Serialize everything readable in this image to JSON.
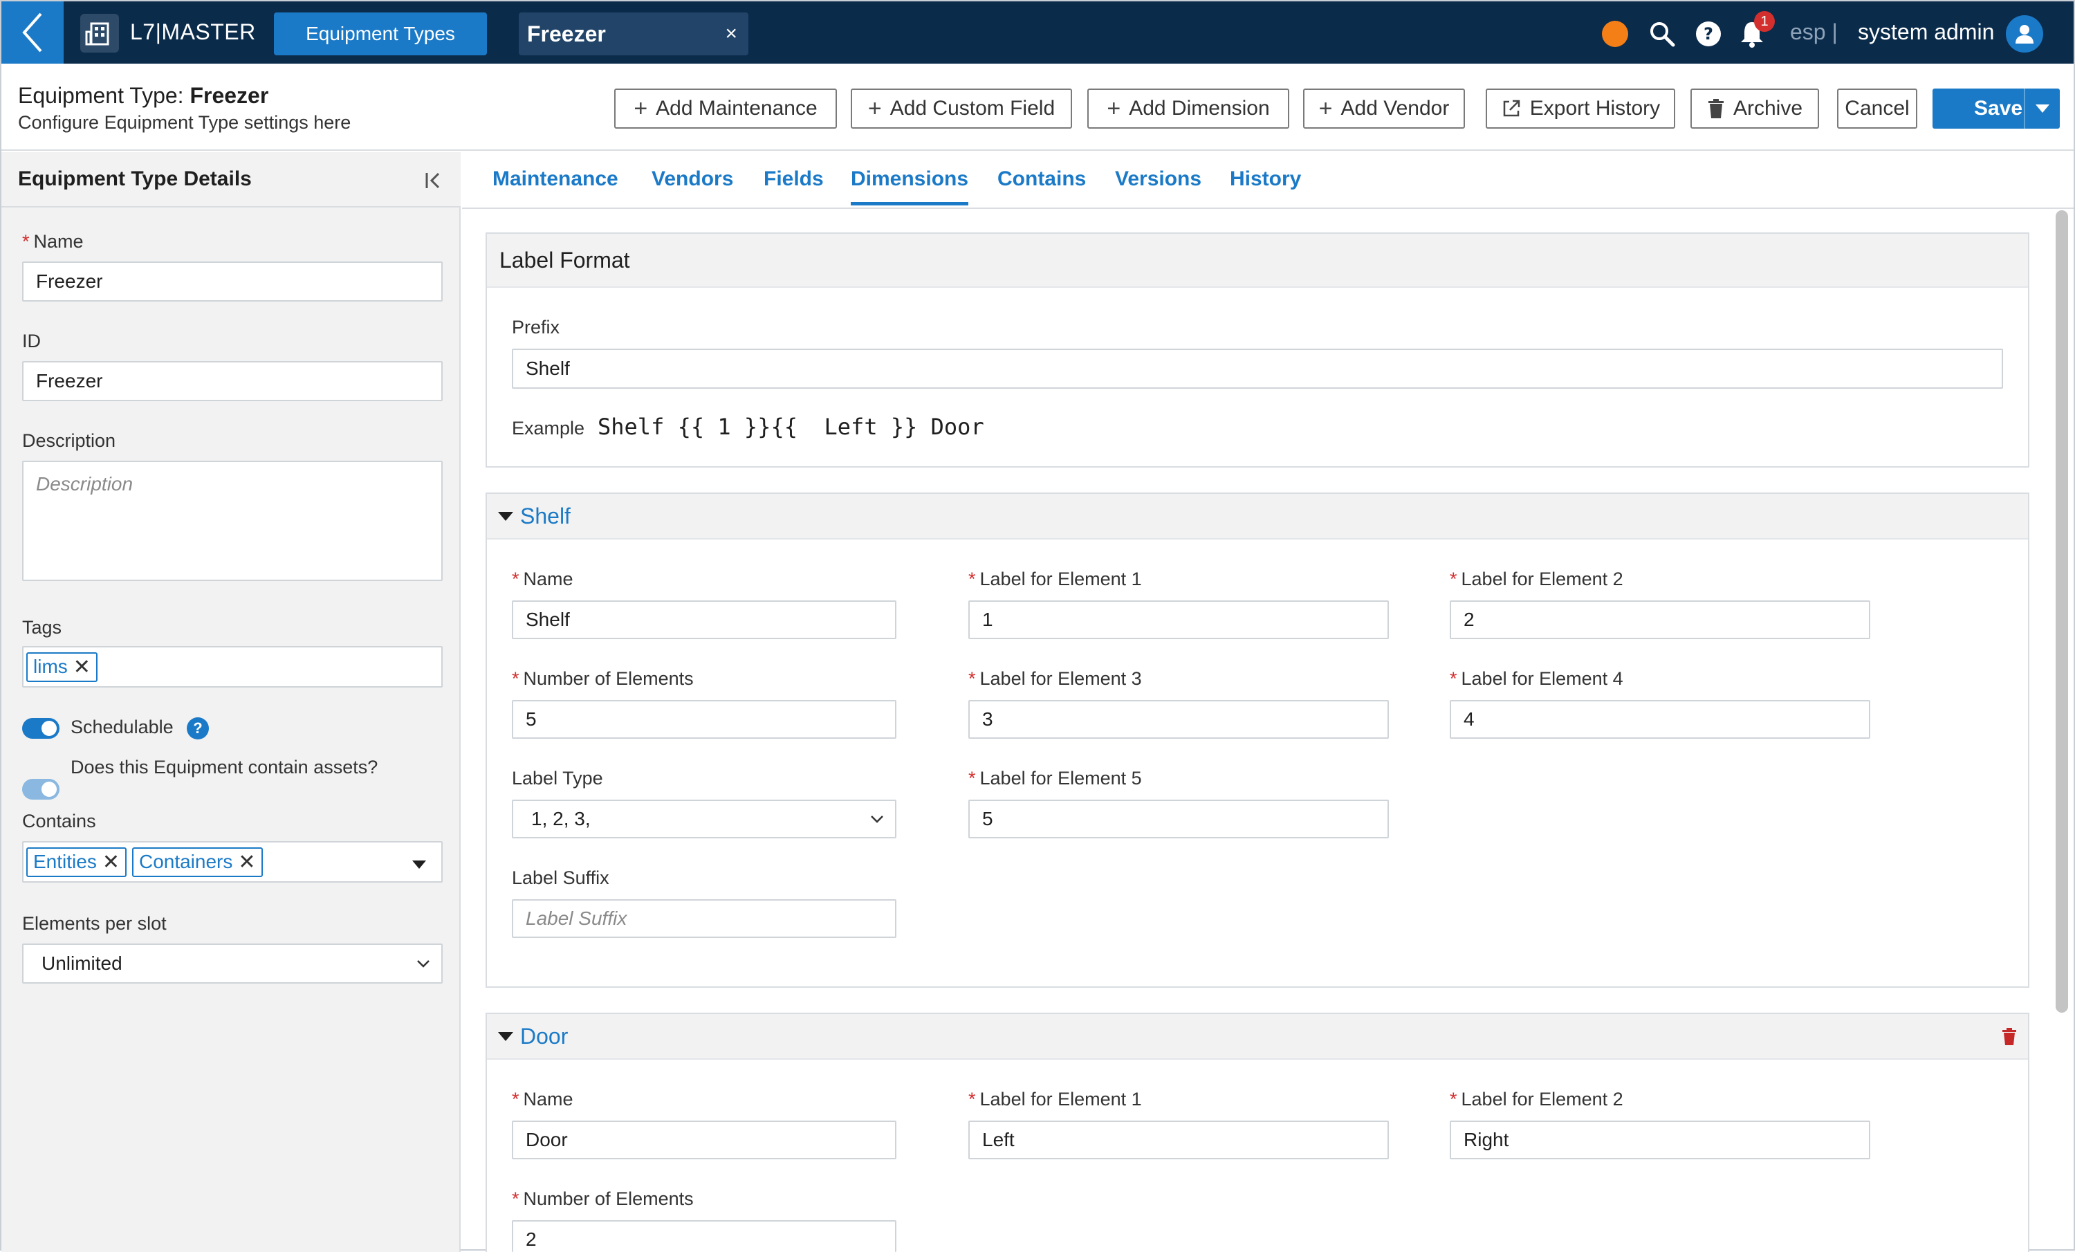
{
  "topbar": {
    "app_name": "L7|MASTER",
    "nav_tab_label": "Equipment Types",
    "record_tab_label": "Freezer",
    "record_tab_close": "×",
    "notification_count": "1",
    "env_label": "esp |",
    "user_name": "system admin"
  },
  "header": {
    "title_prefix": "Equipment Type: ",
    "title_name": "Freezer",
    "subtitle": "Configure Equipment Type settings here",
    "buttons": {
      "add_maintenance": "Add Maintenance",
      "add_custom_field": "Add Custom Field",
      "add_dimension": "Add Dimension",
      "add_vendor": "Add Vendor",
      "export_history": "Export History",
      "archive": "Archive",
      "cancel": "Cancel",
      "save": "Save"
    }
  },
  "left_panel": {
    "title": "Equipment Type Details",
    "name_label": "Name",
    "name_value": "Freezer",
    "id_label": "ID",
    "id_value": "Freezer",
    "description_label": "Description",
    "description_placeholder": "Description",
    "tags_label": "Tags",
    "tags": [
      "lims"
    ],
    "schedulable_label": "Schedulable",
    "schedulable_on": true,
    "contains_assets_label": "Does this Equipment contain assets?",
    "contains_assets_on": true,
    "contains_label": "Contains",
    "contains_values": [
      "Entities",
      "Containers"
    ],
    "elements_per_slot_label": "Elements per slot",
    "elements_per_slot_value": "Unlimited"
  },
  "tabs": [
    "Maintenance",
    "Vendors",
    "Fields",
    "Dimensions",
    "Contains",
    "Versions",
    "History"
  ],
  "active_tab": "Dimensions",
  "label_format": {
    "title": "Label Format",
    "prefix_label": "Prefix",
    "prefix_value": "Shelf",
    "example_label": "Example",
    "example_value": "Shelf {{ 1 }}{{  Left }} Door"
  },
  "shelf": {
    "title": "Shelf",
    "name_label": "Name",
    "name_value": "Shelf",
    "num_elements_label": "Number of Elements",
    "num_elements_value": "5",
    "label_type_label": "Label Type",
    "label_type_value": "1, 2, 3,",
    "label_suffix_label": "Label Suffix",
    "label_suffix_placeholder": "Label Suffix",
    "el1_label": "Label for Element 1",
    "el1_value": "1",
    "el2_label": "Label for Element 2",
    "el2_value": "2",
    "el3_label": "Label for Element 3",
    "el3_value": "3",
    "el4_label": "Label for Element 4",
    "el4_value": "4",
    "el5_label": "Label for Element 5",
    "el5_value": "5"
  },
  "door": {
    "title": "Door",
    "name_label": "Name",
    "name_value": "Door",
    "num_elements_label": "Number of Elements",
    "num_elements_value": "2",
    "el1_label": "Label for Element 1",
    "el1_value": "Left",
    "el2_label": "Label for Element 2",
    "el2_value": "Right"
  },
  "colors": {
    "topbar_bg": "#0b2b4b",
    "accent": "#1b7ac7",
    "status_dot": "#f57f17",
    "required": "#d32f2f",
    "delete": "#c62828"
  },
  "icons": [
    "back-chevron-icon",
    "building-grid-icon",
    "close-icon",
    "search-icon",
    "help-icon",
    "bell-icon",
    "user-avatar-icon",
    "plus-icon",
    "export-icon",
    "trash-icon",
    "collapse-left-icon",
    "chevron-down-icon",
    "caret-down-icon"
  ]
}
